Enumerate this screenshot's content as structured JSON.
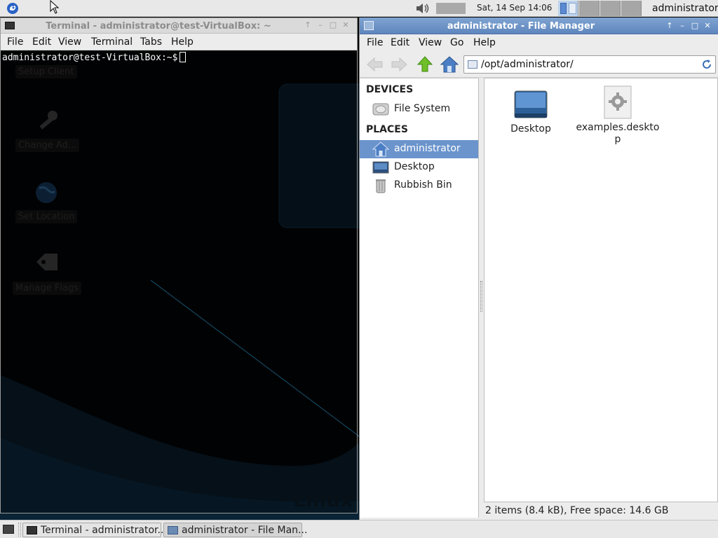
{
  "top_panel": {
    "clock": "Sat, 14 Sep  14:06",
    "user": "administrator",
    "workspaces": [
      {
        "active": true
      },
      {
        "active": false
      },
      {
        "active": false
      },
      {
        "active": false
      }
    ]
  },
  "desktop": {
    "icons": [
      {
        "label": "Setup Client",
        "icon": "setup-client-icon"
      },
      {
        "label": "Change Ad...",
        "icon": "key-icon"
      },
      {
        "label": "Set Location",
        "icon": "globe-icon"
      },
      {
        "label": "Manage Flags",
        "icon": "tag-icon"
      }
    ],
    "watermark": "Linux"
  },
  "terminal": {
    "title": "Terminal - administrator@test-VirtualBox: ~",
    "menu": [
      "File",
      "Edit",
      "View",
      "Terminal",
      "Tabs",
      "Help"
    ],
    "prompt": "administrator@test-VirtualBox:~$"
  },
  "file_manager": {
    "title": "administrator - File Manager",
    "menu": [
      "File",
      "Edit",
      "View",
      "Go",
      "Help"
    ],
    "location": "/opt/administrator/",
    "side": {
      "devices_heading": "DEVICES",
      "devices": [
        {
          "label": "File System",
          "icon": "drive-icon"
        }
      ],
      "places_heading": "PLACES",
      "places": [
        {
          "label": "administrator",
          "icon": "home-icon",
          "selected": true
        },
        {
          "label": "Desktop",
          "icon": "desktop-icon",
          "selected": false
        },
        {
          "label": "Rubbish Bin",
          "icon": "trash-icon",
          "selected": false
        }
      ]
    },
    "files": [
      {
        "label": "Desktop",
        "icon": "folder-desktop-icon"
      },
      {
        "label": "examples.desktop",
        "icon": "settings-file-icon"
      }
    ],
    "status": "2 items (8.4 kB), Free space: 14.6 GB"
  },
  "taskbar": {
    "tasks": [
      {
        "label": "Terminal - administrator...",
        "icon": "terminal-icon",
        "active": false
      },
      {
        "label": "administrator - File Man...",
        "icon": "file-manager-icon",
        "active": true
      }
    ]
  },
  "colors": {
    "selection": "#6b94cc",
    "titlebar_active": "#5f86bd",
    "desktop_bg": "#020406"
  }
}
